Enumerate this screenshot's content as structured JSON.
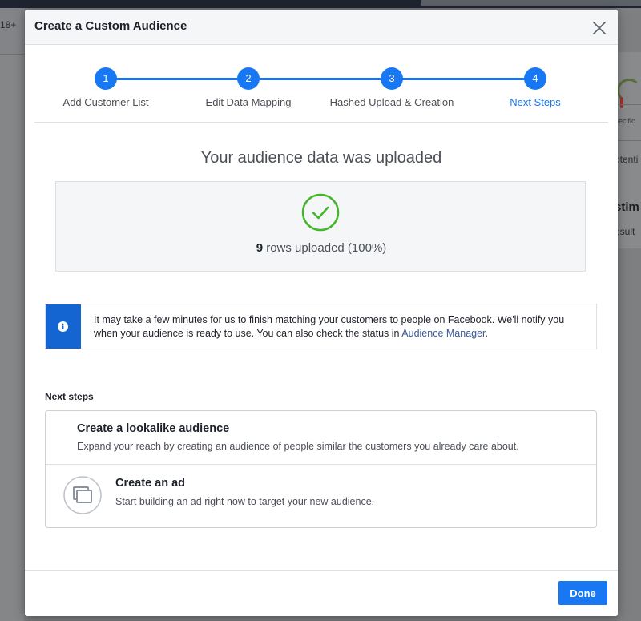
{
  "background": {
    "age_text": "18+",
    "right_texts": [
      "pecific",
      "otenti",
      "stim",
      "esult"
    ]
  },
  "dialog": {
    "title": "Create a Custom Audience",
    "close_icon": "close-icon"
  },
  "stepper": {
    "steps": [
      {
        "number": "1",
        "label": "Add Customer List",
        "active": false
      },
      {
        "number": "2",
        "label": "Edit Data Mapping",
        "active": false
      },
      {
        "number": "3",
        "label": "Hashed Upload & Creation",
        "active": false
      },
      {
        "number": "4",
        "label": "Next Steps",
        "active": true
      }
    ],
    "accent_color": "#1877f2"
  },
  "upload": {
    "heading": "Your audience data was uploaded",
    "icon": "check-circle-icon",
    "rows_count": "9",
    "status_suffix": " rows uploaded (100%)",
    "success_color": "#42b72a"
  },
  "info": {
    "icon": "info-icon",
    "text": "It may take a few minutes for us to finish matching your customers to people on Facebook. We'll notify you when your audience is ready to use. You can also check the status in ",
    "link_text": "Audience Manager",
    "text_end": "."
  },
  "next_steps": {
    "heading": "Next steps",
    "items": [
      {
        "title": "Create a lookalike audience",
        "description": "Expand your reach by creating an audience of people similar the customers you already care about."
      },
      {
        "title": "Create an ad",
        "description": "Start building an ad right now to target your new audience.",
        "icon": "create-ad-icon"
      }
    ]
  },
  "footer": {
    "done_label": "Done"
  }
}
